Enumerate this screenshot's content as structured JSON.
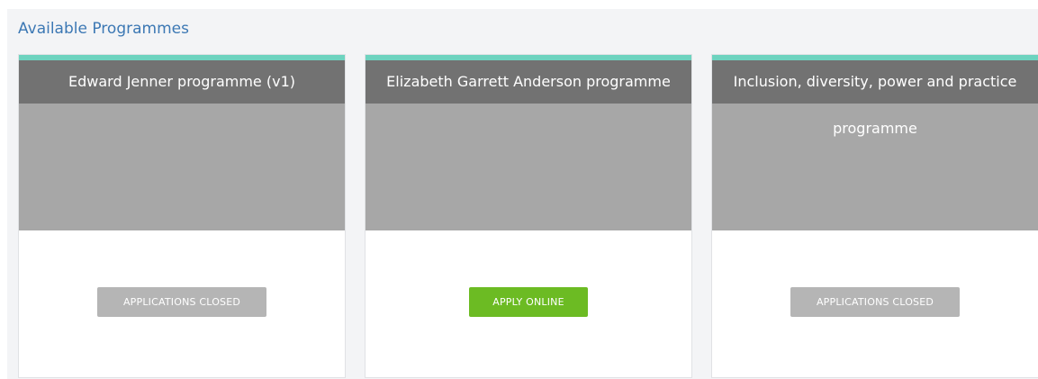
{
  "section": {
    "title": "Available Programmes"
  },
  "cards": [
    {
      "title": "Edward Jenner programme (v1)",
      "title_cont": "",
      "button": "APPLICATIONS CLOSED",
      "status": "closed"
    },
    {
      "title": "Elizabeth Garrett Anderson programme",
      "title_cont": "",
      "button": "APPLY ONLINE",
      "status": "open"
    },
    {
      "title": "Inclusion, diversity, power and practice",
      "title_cont": "programme",
      "button": "APPLICATIONS CLOSED",
      "status": "closed"
    }
  ],
  "colors": {
    "accent": "#6dd3bf",
    "header": "#727272",
    "image_placeholder": "#a7a7a7",
    "apply_button": "#6cbb23",
    "closed_button": "#b5b5b5",
    "title_text": "#3c78b4"
  }
}
